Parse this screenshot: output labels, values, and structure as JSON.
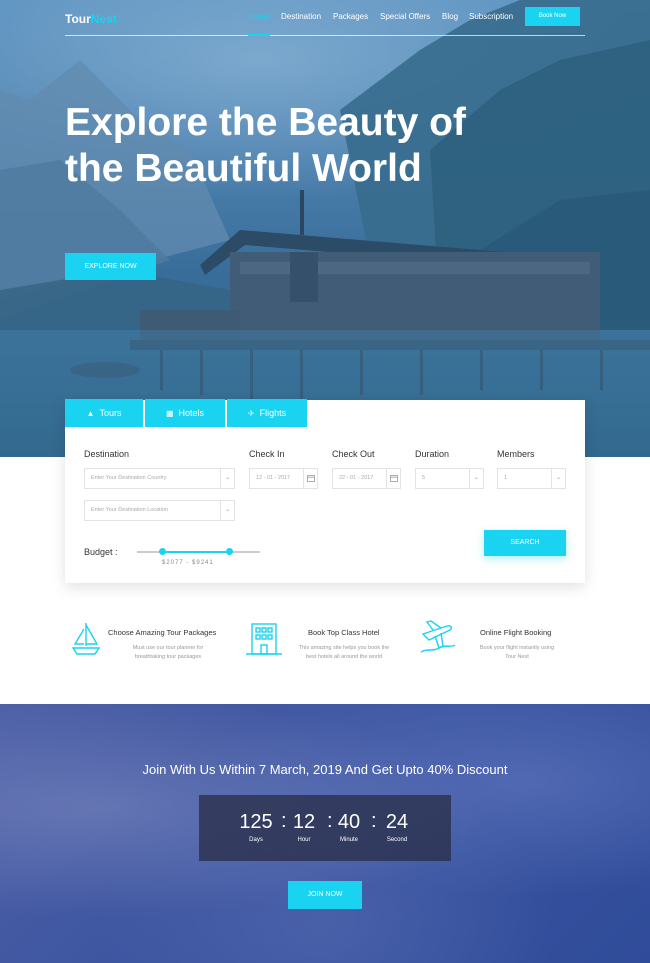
{
  "nav": {
    "logo_main": "Tour",
    "logo_accent": "Nest",
    "links": [
      "Home",
      "Destination",
      "Packages",
      "Special Offers",
      "Blog",
      "Subscription"
    ],
    "book_button": "Book Now"
  },
  "hero": {
    "title": "Explore the Beauty of the Beautiful World",
    "cta": "EXPLORE NOW"
  },
  "search": {
    "tabs": [
      "Tours",
      "Hotels",
      "Flights"
    ],
    "labels": {
      "destination": "Destination",
      "check_in": "Check In",
      "check_out": "Check Out",
      "duration": "Duration",
      "members": "Members",
      "budget": "Budget :"
    },
    "destination_country_placeholder": "Enter Your Destination Country",
    "destination_location_placeholder": "Enter Your Destination Location",
    "check_in_value": "12 - 01 - 2017",
    "check_out_value": "22 - 01 - 2017",
    "duration_value": "5",
    "members_value": "1",
    "budget_range": "$2077 - $9241",
    "search_button": "SEARCH"
  },
  "features": [
    {
      "title": "Choose Amazing Tour Packages",
      "desc1": "Must use our tour planner for",
      "desc2": "breathtaking tour packages"
    },
    {
      "title": "Book Top Class Hotel",
      "desc1": "This amazing site helps you book the",
      "desc2": "best hotels all around the world"
    },
    {
      "title": "Online Flight Booking",
      "desc1": "Book your flight instantly using",
      "desc2": "Tour Nest"
    }
  ],
  "countdown": {
    "title": "Join With Us Within 7 March, 2019 And Get Upto 40% Discount",
    "days": "125",
    "hours": "12",
    "minutes": "40",
    "seconds": "24",
    "days_label": "Days",
    "hours_label": "Hour",
    "minutes_label": "Minute",
    "seconds_label": "Second",
    "button": "JOIN NOW"
  },
  "colors": {
    "accent": "#19d3f0",
    "hero_overlay": "#286eb4",
    "countdown_bg": "#3c55a0"
  }
}
